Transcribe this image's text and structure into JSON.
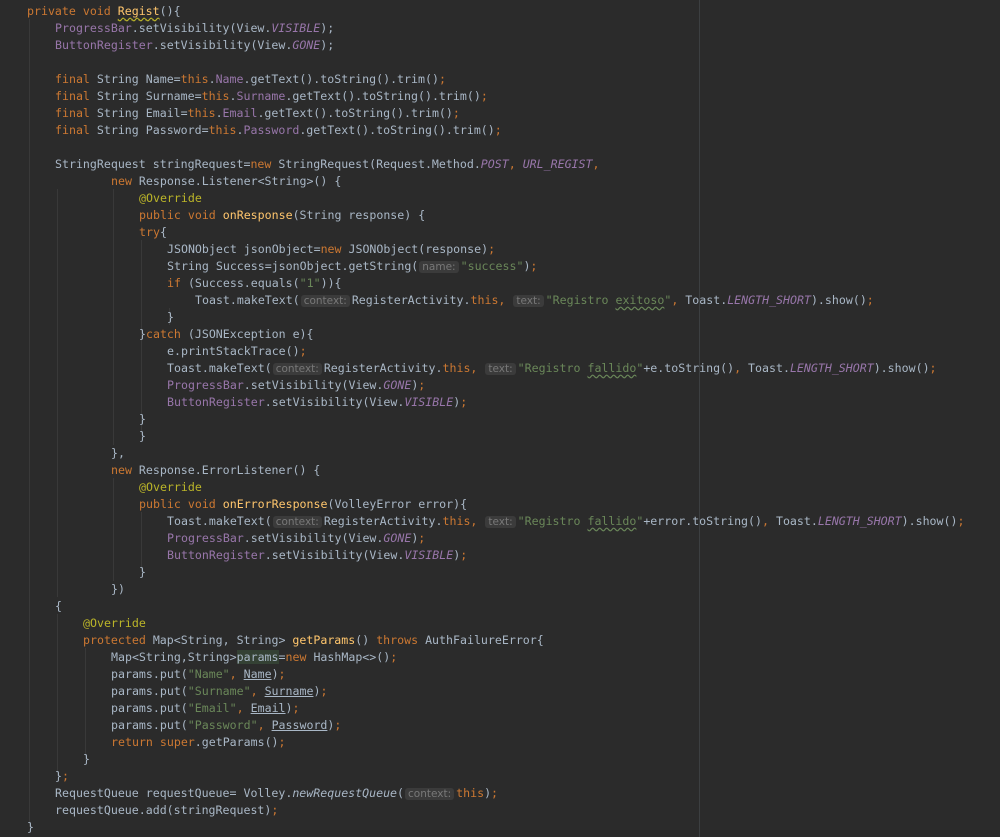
{
  "editor": {
    "language": "Java",
    "colors": {
      "background": "#2b2b2b",
      "text": "#a9b7c6",
      "keyword": "#cc7832",
      "field": "#9876aa",
      "string": "#6a8759",
      "annotation": "#bbb529",
      "method_declaration": "#ffc66d",
      "hint": "#787878"
    }
  },
  "code": {
    "l01": {
      "a": "private void ",
      "b": "Regist",
      "c": "(){"
    },
    "l02": {
      "a": "ProgressBar",
      "b": ".setVisibility(View.",
      "c": "VISIBLE",
      "d": ");"
    },
    "l03": {
      "a": "ButtonRegister",
      "b": ".setVisibility(View.",
      "c": "GONE",
      "d": ");"
    },
    "l05": {
      "a": "final ",
      "b": "String Name=",
      "c": "this",
      "d": ".",
      "e": "Name",
      "f": ".getText().toString().trim()",
      ";": ";"
    },
    "l06": {
      "a": "final ",
      "b": "String Surname=",
      "c": "this",
      "d": ".",
      "e": "Surname",
      "f": ".getText().toString().trim()",
      ";": ";"
    },
    "l07": {
      "a": "final ",
      "b": "String Email=",
      "c": "this",
      "d": ".",
      "e": "Email",
      "f": ".getText().toString().trim()",
      ";": ";"
    },
    "l08": {
      "a": "final ",
      "b": "String Password=",
      "c": "this",
      "d": ".",
      "e": "Password",
      "f": ".getText().toString().trim()",
      ";": ";"
    },
    "l10": {
      "a": "StringRequest stringRequest=",
      "b": "new ",
      "c": "StringRequest(Request.Method.",
      "d": "POST",
      ",": ", ",
      "e": "URL_REGIST",
      "f": ","
    },
    "l11": {
      "a": "new ",
      "b": "Response.Listener<String>() {"
    },
    "l12": {
      "a": "@Override"
    },
    "l13": {
      "a": "public void ",
      "b": "onResponse",
      "c": "(String response) {"
    },
    "l14": {
      "a": "try",
      "b": "{"
    },
    "l15": {
      "a": "JSONObject jsonObject=",
      "b": "new ",
      "c": "JSONObject(response)",
      ";": ";"
    },
    "l16": {
      "a": "String Success=jsonObject.getString(",
      "hint": "name:",
      "s": "\"success\"",
      "e": ")",
      ";": ";"
    },
    "l17": {
      "a": "if ",
      "b": "(Success.equals(",
      "s": "\"1\"",
      "c": ")){"
    },
    "l18": {
      "a": "Toast.makeText(",
      "h1": "context:",
      "b": "RegisterActivity.",
      "c": "this",
      ",": ", ",
      "h2": "text:",
      "s1": "\"Registro ",
      "s2": "exitoso",
      "s3": "\"",
      ",2": ", ",
      "d": "Toast.",
      "e": "LENGTH_SHORT",
      "f": ").show()",
      ";": ";"
    },
    "l19": {
      "a": "}"
    },
    "l20": {
      "a": "}",
      "b": "catch ",
      "c": "(JSONException e){"
    },
    "l21": {
      "a": "e.printStackTrace()",
      ";": ";"
    },
    "l22": {
      "a": "Toast.makeText(",
      "h1": "context:",
      "b": "RegisterActivity.",
      "c": "this",
      ",": ", ",
      "h2": "text:",
      "s1": "\"Registro ",
      "s2": "fallido",
      "s3": "\"",
      "d": "+e.toString()",
      ",2": ", ",
      "e": "Toast.",
      "f": "LENGTH_SHORT",
      "g": ").show()",
      ";": ";"
    },
    "l23": {
      "a": "ProgressBar",
      "b": ".setVisibility(View.",
      "c": "GONE",
      "d": ")",
      ";": ";"
    },
    "l24": {
      "a": "ButtonRegister",
      "b": ".setVisibility(View.",
      "c": "VISIBLE",
      "d": ")",
      ";": ";"
    },
    "l25": {
      "a": "}"
    },
    "l26": {
      "a": "}"
    },
    "l27": {
      "a": "},"
    },
    "l28": {
      "a": "new ",
      "b": "Response.ErrorListener() {"
    },
    "l29": {
      "a": "@Override"
    },
    "l30": {
      "a": "public void ",
      "b": "onErrorResponse",
      "c": "(VolleyError error){"
    },
    "l31": {
      "a": "Toast.makeText(",
      "h1": "context:",
      "b": "RegisterActivity.",
      "c": "this",
      ",": ", ",
      "h2": "text:",
      "s1": "\"Registro ",
      "s2": "fallido",
      "s3": "\"",
      "d": "+error.toString()",
      ",2": ", ",
      "e": "Toast.",
      "f": "LENGTH_SHORT",
      "g": ").show()",
      ";": ";"
    },
    "l32": {
      "a": "ProgressBar",
      "b": ".setVisibility(View.",
      "c": "GONE",
      "d": ")",
      ";": ";"
    },
    "l33": {
      "a": "ButtonRegister",
      "b": ".setVisibility(View.",
      "c": "VISIBLE",
      "d": ")",
      ";": ";"
    },
    "l34": {
      "a": "}"
    },
    "l35": {
      "a": "})"
    },
    "l36": {
      "a": "{"
    },
    "l37": {
      "a": "@Override"
    },
    "l38": {
      "a": "protected ",
      "b": "Map<String, String> ",
      "c": "getParams",
      "d": "() ",
      "e": "throws ",
      "f": "AuthFailureError{"
    },
    "l39": {
      "a": "Map<String,String>",
      "b": "params",
      "c": "=",
      "d": "new ",
      "e": "HashMap<>()",
      ";": ";"
    },
    "l40": {
      "a": "params.put(",
      "s": "\"Name\"",
      ",": ", ",
      "b": "Name",
      "c": ")",
      ";": ";"
    },
    "l41": {
      "a": "params.put(",
      "s": "\"Surname\"",
      ",": ", ",
      "b": "Surname",
      "c": ")",
      ";": ";"
    },
    "l42": {
      "a": "params.put(",
      "s": "\"Email\"",
      ",": ", ",
      "b": "Email",
      "c": ")",
      ";": ";"
    },
    "l43": {
      "a": "params.put(",
      "s": "\"Password\"",
      ",": ", ",
      "b": "Password",
      "c": ")",
      ";": ";"
    },
    "l44": {
      "a": "return ",
      "b": "super",
      "c": ".getParams()",
      ";": ";"
    },
    "l45": {
      "a": "}"
    },
    "l46": {
      "a": "}",
      ";": ";"
    },
    "l47": {
      "a": "RequestQueue requestQueue= Volley.",
      "b": "newRequestQueue",
      "c": "(",
      "h": "context:",
      "d": "this",
      "e": ")",
      ";": ";"
    },
    "l48": {
      "a": "requestQueue.add(stringRequest)",
      ";": ";"
    },
    "l49": {
      "a": "}"
    }
  }
}
